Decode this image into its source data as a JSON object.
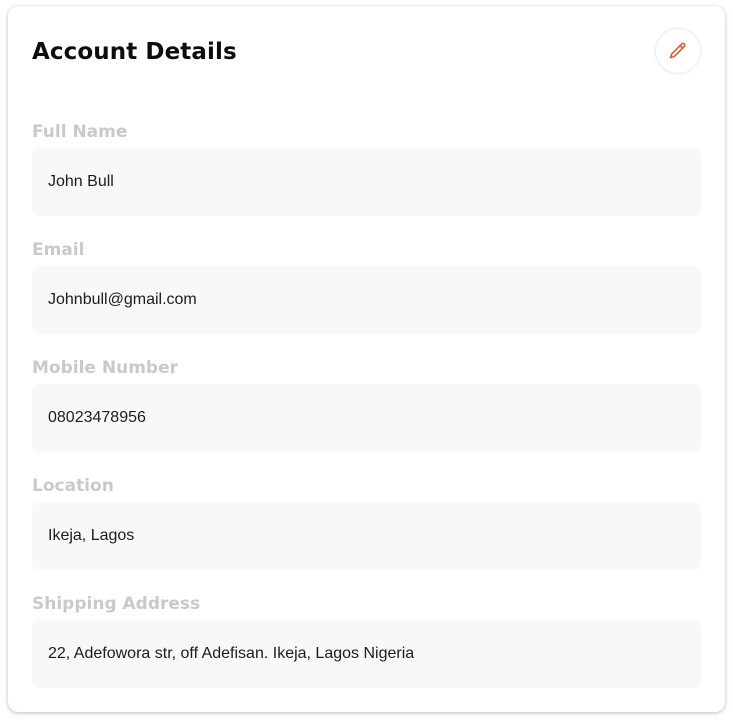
{
  "card": {
    "title": "Account Details",
    "edit_icon": "pencil-icon",
    "accent_color": "#e0582b"
  },
  "fields": [
    {
      "label": "Full Name",
      "value": "John Bull"
    },
    {
      "label": "Email",
      "value": "Johnbull@gmail.com"
    },
    {
      "label": "Mobile Number",
      "value": "08023478956"
    },
    {
      "label": "Location",
      "value": "Ikeja, Lagos"
    },
    {
      "label": "Shipping Address",
      "value": "22, Adefowora str, off Adefisan. Ikeja, Lagos Nigeria"
    }
  ]
}
